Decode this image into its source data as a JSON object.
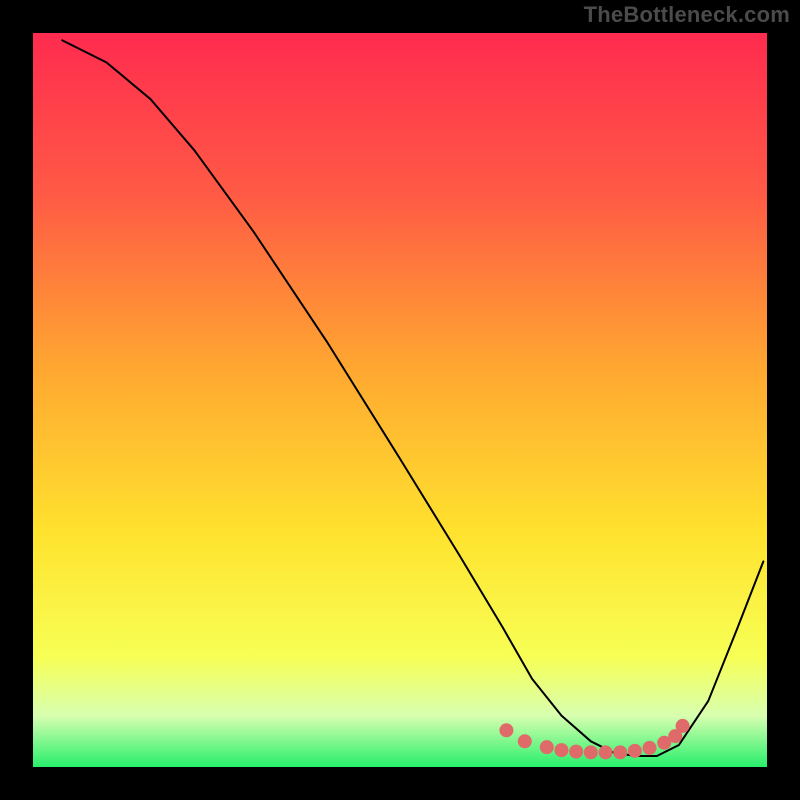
{
  "watermark": "TheBottleneck.com",
  "chart_data": {
    "type": "line",
    "title": "",
    "xlabel": "",
    "ylabel": "",
    "xlim": [
      0,
      100
    ],
    "ylim": [
      0,
      100
    ],
    "gradient_stops": [
      {
        "offset": 0,
        "color": "#ff2b4f"
      },
      {
        "offset": 22,
        "color": "#ff5a45"
      },
      {
        "offset": 45,
        "color": "#ffa531"
      },
      {
        "offset": 68,
        "color": "#ffe22e"
      },
      {
        "offset": 85,
        "color": "#f7ff55"
      },
      {
        "offset": 93,
        "color": "#d8ffb0"
      },
      {
        "offset": 100,
        "color": "#27ef6b"
      }
    ],
    "series": [
      {
        "name": "bottleneck-curve",
        "color": "#000000",
        "x": [
          4,
          10,
          16,
          22,
          30,
          40,
          50,
          58,
          64,
          68,
          72,
          76,
          79,
          82,
          85,
          88,
          92,
          96,
          99.5
        ],
        "y": [
          99,
          96,
          91,
          84,
          73,
          58,
          42,
          29,
          19,
          12,
          7,
          3.5,
          2,
          1.5,
          1.5,
          3,
          9,
          19,
          28
        ]
      }
    ],
    "marker_series": {
      "name": "optimal-range-markers",
      "color": "#e06a6a",
      "radius_px": 7,
      "x": [
        64.5,
        67,
        70,
        72,
        74,
        76,
        78,
        80,
        82,
        84,
        86,
        87.5,
        88.5
      ],
      "y": [
        5.0,
        3.5,
        2.7,
        2.3,
        2.1,
        2.0,
        2.0,
        2.0,
        2.2,
        2.6,
        3.3,
        4.2,
        5.6
      ]
    }
  }
}
